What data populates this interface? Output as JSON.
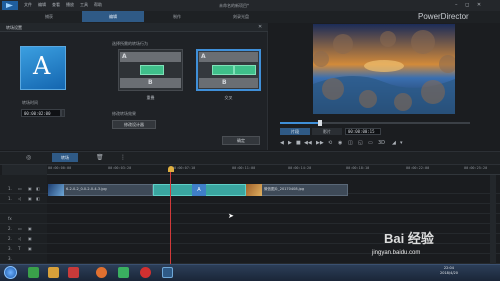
{
  "app": {
    "menus": [
      "文件",
      "编辑",
      "查看",
      "播放",
      "工具",
      "帮助"
    ],
    "window_title": "未命名的新项目*",
    "brand": "PowerDirector",
    "window_controls": "– ◻ ✕"
  },
  "mode_tabs": [
    {
      "label": "捕获",
      "active": false
    },
    {
      "label": "编辑",
      "active": true
    },
    {
      "label": "制作",
      "active": false
    },
    {
      "label": "刻录光盘",
      "active": false
    }
  ],
  "panel": {
    "title": "转场设置",
    "thumb_letter": "A",
    "duration_label": "转场时间",
    "duration_value": "00:00:02:00",
    "behavior_label": "选择所需的转场行为",
    "behaviors": [
      {
        "caption": "重叠",
        "a": "A",
        "b": "B",
        "selected": false
      },
      {
        "caption": "交叉",
        "a": "A",
        "b": "B",
        "selected": true
      }
    ],
    "modify_label": "修改转场效果",
    "modify_button": "修改设计器",
    "ok_button": "确定"
  },
  "preview": {
    "clip_button": "片段",
    "movie_button": "影片",
    "timecode": "00:00:00:15",
    "controls": [
      "◀",
      "▶",
      "■",
      "◀◀",
      "▶▶",
      "⟲",
      "◉",
      "◫",
      "◱",
      "▭",
      "3D",
      "◢",
      "▾"
    ]
  },
  "timeline": {
    "fx_button": "转场",
    "ruler_labels": [
      "00:00:00:00",
      "00:00:03:20",
      "00:00:07:10",
      "00:00:11:00",
      "00:00:14:20",
      "00:00:18:10",
      "00:00:22:00",
      "00:00:25:20"
    ],
    "clips": [
      {
        "label": "6-2-0-2_0-0-2-0-4-3.jpg"
      },
      {
        "label": "微信图片_20170408.jpg"
      }
    ],
    "transition_label": "A",
    "track_numbers": [
      "1.",
      "1.",
      "",
      "fx",
      "2.",
      "2.",
      "",
      "3.",
      "3."
    ]
  },
  "taskbar": {
    "clock_time": "22:04",
    "clock_date": "2018/4/20"
  },
  "watermark": {
    "logo": "Bai 经验",
    "url": "jingyan.baidu.com"
  }
}
